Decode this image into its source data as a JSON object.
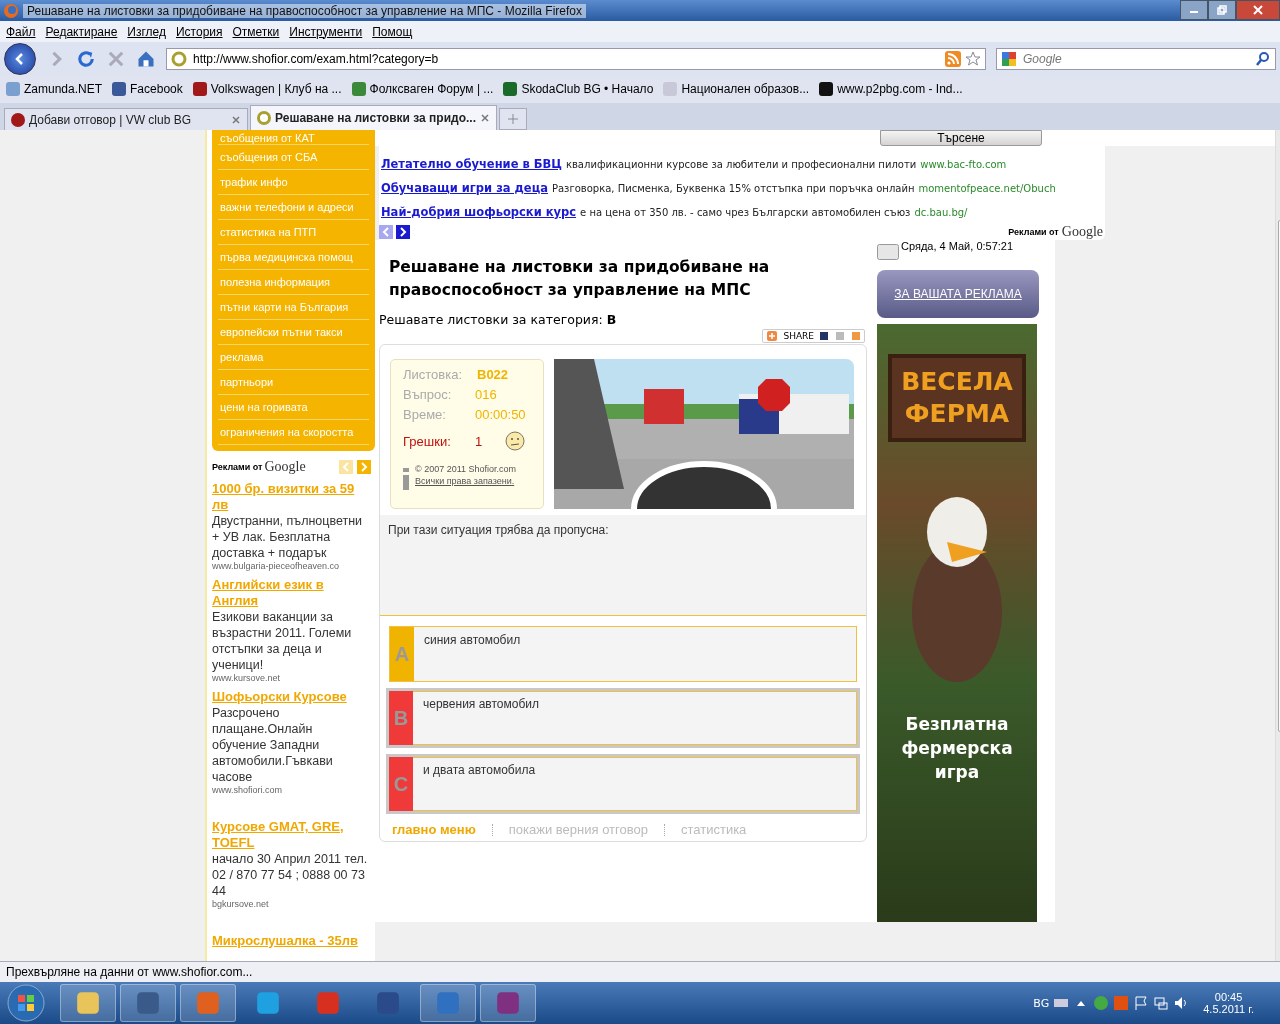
{
  "window": {
    "title": "Решаване на листовки за придобиване на правоспособност за управление на МПС - Mozilla Firefox"
  },
  "menu": [
    "Файл",
    "Редактиране",
    "Изглед",
    "История",
    "Отметки",
    "Инструменти",
    "Помощ"
  ],
  "address": {
    "value": "http://www.shofior.com/exam.html?category=b"
  },
  "search": {
    "placeholder": "Google"
  },
  "bookmarks": [
    "Zamunda.NET",
    "Facebook",
    "Volkswagen | Клуб на ...",
    "Фолксваген Форум | ...",
    "SkodaClub BG • Начало",
    "Национален образов...",
    "www.p2pbg.com - Ind..."
  ],
  "tabs": [
    {
      "label": "Добави отговор | VW club BG",
      "selected": false
    },
    {
      "label": "Решаване на листовки за придо...",
      "selected": true
    }
  ],
  "sidebar": {
    "items": [
      "съобщения от КАТ",
      "съобщения от СБА",
      "трафик инфо",
      "важни телефони и адреси",
      "статистика на ПТП",
      "първа медицинска помощ",
      "полезна информация",
      "пътни карти на България",
      "европейски пътни такси",
      "реклама",
      "партньори",
      "цени на горивата",
      "ограничения на скоростта"
    ],
    "ads_label": "Реклами от",
    "ads_brand": "Google",
    "ads": [
      {
        "title": "1000 бр. визитки за 59 лв",
        "text": "Двустранни, пълноцветни + УВ лак. Безплатна доставка + подарък",
        "url": "www.bulgaria-pieceofheaven.co"
      },
      {
        "title": "Английски език в Англия",
        "text": "Езикови ваканции за възрастни 2011. Големи отстъпки за деца и ученици!",
        "url": "www.kursove.net"
      },
      {
        "title": "Шофьорски Курсове",
        "text": "Разсрочено плащане.Онлайн обучение Западни автомобили.Гъвкави часове",
        "url": "www.shofiori.com"
      },
      {
        "title": "Курсове GMAT, GRE, TOEFL",
        "text": "начало 30 Април 2011 тел. 02 / 870 77 54 ; 0888 00 73 44",
        "url": "bgkursove.net"
      },
      {
        "title": "Микрослушалка - 35лв"
      }
    ]
  },
  "search_button": "Търсене",
  "top_ads": {
    "items": [
      {
        "title": "Летателно обучение в БВЦ",
        "text": "квалификационни курсове за любители и професионални пилоти",
        "url": "www.bac-fto.com"
      },
      {
        "title": "Обучаващи игри за деца",
        "text": "Разговорка, Писменка, Буквенка 15% отстъпка при поръчка онлайн",
        "url": "momentofpeace.net/Obuch"
      },
      {
        "title": "Най-добрия шофьорски курс",
        "text": "е на цена от 350 лв. - само чрез Български автомобилен съюз",
        "url": "dc.bau.bg/"
      }
    ],
    "label": "Реклами от",
    "brand": "Google"
  },
  "heading": "Решаване на листовки за придобиване на правоспособност за управление на МПС",
  "category_line": "Решавате листовки за категория: **B**",
  "share": "SHARE",
  "quiz": {
    "info": [
      {
        "label": "Листовка:",
        "value": "B022",
        "kind": "bold"
      },
      {
        "label": "Въпрос:",
        "value": "016",
        "kind": "plain"
      },
      {
        "label": "Време:",
        "value": "00:00:50",
        "kind": "plain"
      },
      {
        "label": "Грешки:",
        "value": "1",
        "kind": "error"
      }
    ],
    "copyright": "© 2007 2011 Shofior.com",
    "rights": "Всички права запазени.",
    "question": "При тази ситуация трябва да пропусна:",
    "answers": [
      {
        "letter": "A",
        "text": "синия автомобил",
        "color": "#f0b400",
        "selected": false
      },
      {
        "letter": "B",
        "text": "червения автомобил",
        "color": "#f03a3a",
        "selected": true
      },
      {
        "letter": "C",
        "text": "и двата автомобила",
        "color": "#f03a3a",
        "selected": true
      }
    ],
    "links": [
      {
        "label": "главно меню",
        "disabled": false
      },
      {
        "label": "покажи верния отговор",
        "disabled": true
      },
      {
        "label": "статистика",
        "disabled": true
      }
    ]
  },
  "right": {
    "date": "Сряда, 4 Май, 0:57:21",
    "ad_button": "ЗА ВАШАТА РЕКЛАМА",
    "banner_title": "ВЕСЕЛА ФЕРМА",
    "banner_text": "Безплатна фермерска игра"
  },
  "status_bar": "Прехвърляне на данни от www.shofior.com...",
  "taskbar": {
    "language": "BG",
    "time": "00:45",
    "date": "4.5.2011 г."
  }
}
